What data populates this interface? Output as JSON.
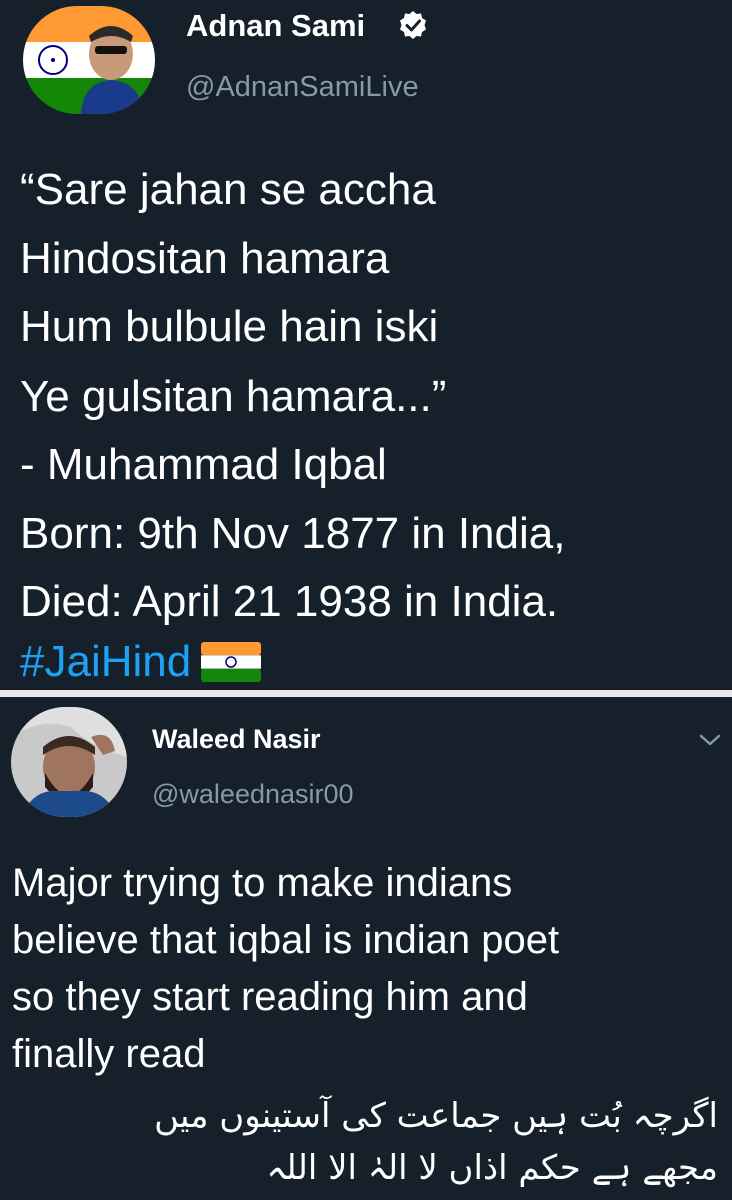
{
  "tweet1": {
    "author_name": "Adnan Sami",
    "handle": "@AdnanSamiLive",
    "verified_icon": "verified-badge-icon",
    "lines": [
      "“Sare jahan se accha",
      "Hindositan hamara",
      "Hum bulbule hain iski",
      "Ye gulsitan hamara...”",
      "- Muhammad Iqbal",
      "Born: 9th Nov 1877 in India,",
      "Died: April 21 1938 in India."
    ],
    "hashtag": "#JaiHind",
    "emoji": "india-flag-emoji"
  },
  "tweet2": {
    "author_name": "Waleed Nasir",
    "handle": "@waleednasir00",
    "menu_icon": "chevron-down-icon",
    "lines": [
      "Major trying to make indians",
      "believe  that iqbal is indian poet",
      "so they start reading him and",
      "finally read"
    ],
    "urdu_lines": [
      "اگرچہ بُت ہیں جماعت کی آستینوں میں",
      "مجھے ہے حکم اذاں لا الہٰ الا اللہ"
    ]
  },
  "colors": {
    "background": "#15202b",
    "text": "#ffffff",
    "secondary_text": "#8899a6",
    "link": "#1da1f2",
    "divider": "#e8e8e8"
  }
}
